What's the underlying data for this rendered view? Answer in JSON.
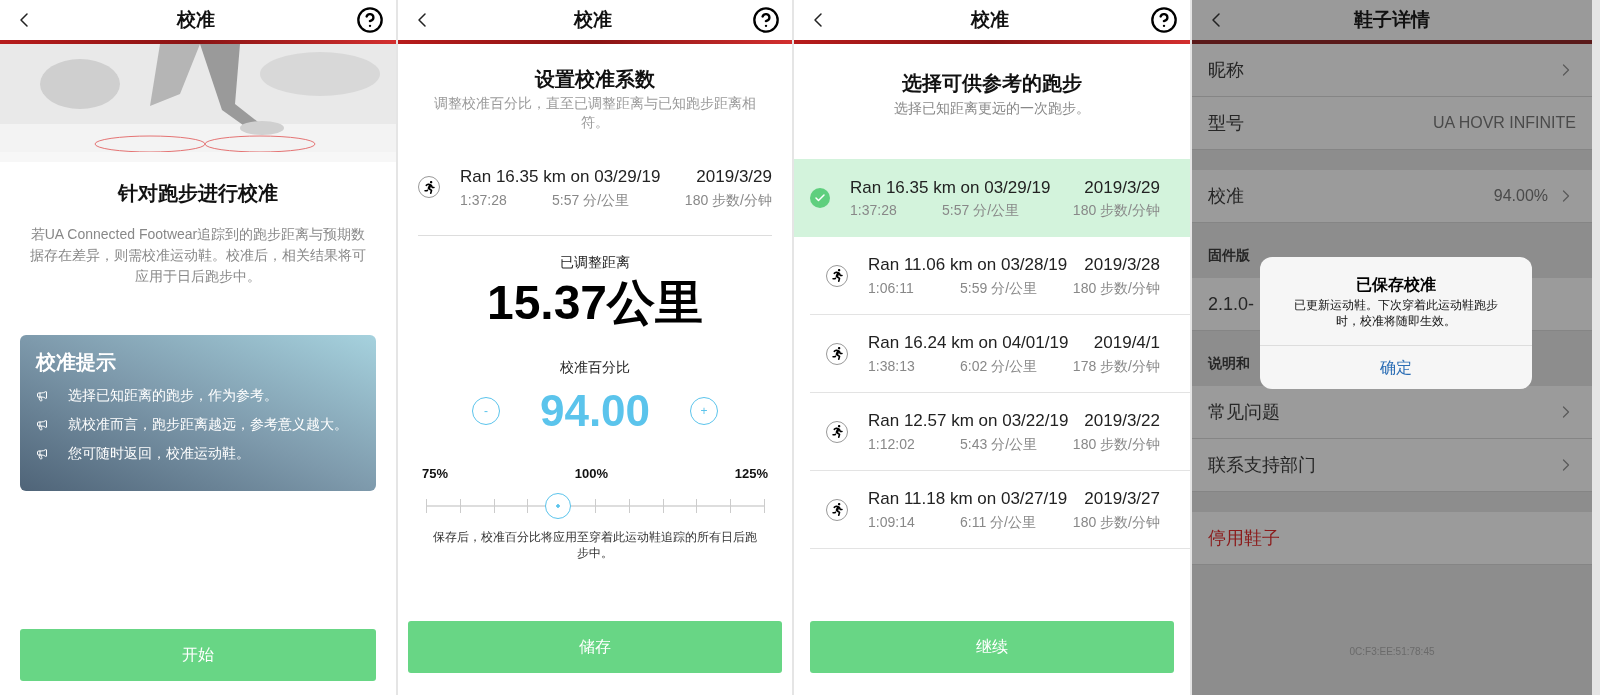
{
  "intro_screen": {
    "header": {
      "title": "校准"
    },
    "heading": "针对跑步进行校准",
    "description": "若UA Connected Footwear追踪到的跑步距离与预期数据存在差异，则需校准运动鞋。校准后，相关结果将可应用于日后跑步中。",
    "tips": {
      "title": "校准提示",
      "items": [
        "选择已知距离的跑步，作为参考。",
        "就校准而言，跑步距离越远，参考意义越大。",
        "您可随时返回，校准运动鞋。"
      ]
    },
    "button": "开始"
  },
  "factor_screen": {
    "header": {
      "title": "校准"
    },
    "heading": "设置校准系数",
    "description": "调整校准百分比，直至已调整距离与已知跑步距离相符。",
    "run": {
      "title": "Ran 16.35 km on 03/29/19",
      "duration": "1:37:28",
      "pace": "5:57 分/公里",
      "date": "2019/3/29",
      "cadence": "180 步数/分钟"
    },
    "adjusted_label": "已调整距离",
    "adjusted_value": "15.37公里",
    "percent_label": "校准百分比",
    "minus": "-",
    "percent_value": "94.00",
    "plus": "+",
    "slider": {
      "min_label": "75%",
      "mid_label": "100%",
      "max_label": "125%",
      "level": 0.38
    },
    "note": "保存后，校准百分比将应用至穿着此运动鞋追踪的所有日后跑步中。",
    "button": "储存"
  },
  "select_screen": {
    "header": {
      "title": "校准"
    },
    "heading": "选择可供参考的跑步",
    "description": "选择已知距离更远的一次跑步。",
    "runs": [
      {
        "title": "Ran 16.35 km on 03/29/19",
        "duration": "1:37:28",
        "pace": "5:57 分/公里",
        "date": "2019/3/29",
        "cadence": "180 步数/分钟",
        "selected": true
      },
      {
        "title": "Ran 11.06 km on 03/28/19",
        "duration": "1:06:11",
        "pace": "5:59 分/公里",
        "date": "2019/3/28",
        "cadence": "180 步数/分钟",
        "selected": false
      },
      {
        "title": "Ran 16.24 km on 04/01/19",
        "duration": "1:38:13",
        "pace": "6:02 分/公里",
        "date": "2019/4/1",
        "cadence": "178 步数/分钟",
        "selected": false
      },
      {
        "title": "Ran 12.57 km on 03/22/19",
        "duration": "1:12:02",
        "pace": "5:43 分/公里",
        "date": "2019/3/22",
        "cadence": "180 步数/分钟",
        "selected": false
      },
      {
        "title": "Ran 11.18 km on 03/27/19",
        "duration": "1:09:14",
        "pace": "6:11 分/公里",
        "date": "2019/3/27",
        "cadence": "180 步数/分钟",
        "selected": false
      }
    ],
    "button": "继续"
  },
  "details_screen": {
    "header": {
      "title": "鞋子详情"
    },
    "items": [
      {
        "kind": "row",
        "label": "昵称",
        "chevron": true
      },
      {
        "kind": "row",
        "label": "型号",
        "value": "UA HOVR INFINITE",
        "chevron": false
      },
      {
        "kind": "spacer"
      },
      {
        "kind": "row",
        "label": "校准",
        "value": "94.00%",
        "chevron": true
      },
      {
        "kind": "section",
        "label": "固件版"
      },
      {
        "kind": "row",
        "label": "2.1.0-",
        "chevron": false
      },
      {
        "kind": "section",
        "label": "说明和"
      },
      {
        "kind": "row",
        "label": "常见问题",
        "chevron": true
      },
      {
        "kind": "row",
        "label": "联系支持部门",
        "chevron": true
      },
      {
        "kind": "spacer"
      },
      {
        "kind": "danger",
        "label": "停用鞋子",
        "chevron": false
      }
    ],
    "footer": "0C:F3:EE:51:78:45",
    "dialog": {
      "title": "已保存校准",
      "message": "已更新运动鞋。下次穿着此运动鞋跑步时，校准将随即生效。",
      "button": "确定"
    }
  }
}
